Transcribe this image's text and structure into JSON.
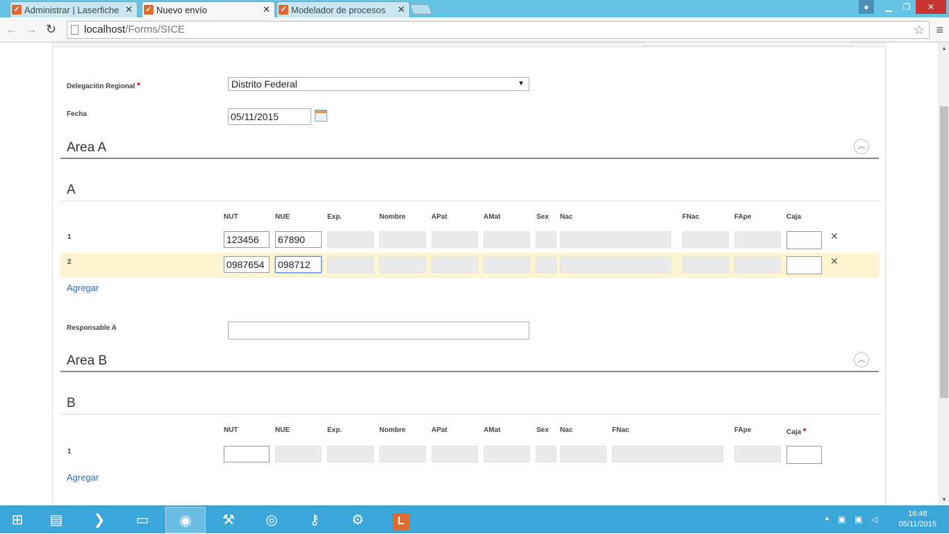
{
  "browser": {
    "tabs": [
      {
        "label": "Administrar | Laserfiche Fo",
        "active": false
      },
      {
        "label": "Nuevo envío",
        "active": true
      },
      {
        "label": "Modelador de procesos | L",
        "active": false
      }
    ],
    "url_host": "localhost",
    "url_path": "/Forms/SICE"
  },
  "form": {
    "delegacion": {
      "label": "Delegación Regional",
      "required_mark": "*",
      "value": "Distrito Federal"
    },
    "fecha": {
      "label": "Fecha",
      "value": "05/11/2015"
    },
    "area_a": {
      "title": "Area A",
      "subtitle": "A",
      "columns": [
        "NUT",
        "NUE",
        "Exp.",
        "Nombre",
        "APat",
        "AMat",
        "Sex",
        "Nac",
        "FNac",
        "FApe",
        "Caja"
      ],
      "rows": [
        {
          "num": "1",
          "nut": "123456",
          "nue": "67890"
        },
        {
          "num": "2",
          "nut": "0987654",
          "nue": "098712"
        }
      ],
      "add_label": "Agregar",
      "responsable_label": "Responsable A"
    },
    "area_b": {
      "title": "Area B",
      "subtitle": "B",
      "columns": [
        "NUT",
        "NUE",
        "Exp.",
        "Nombre",
        "APat",
        "AMat",
        "Sex",
        "Nac",
        "FNac",
        "FApe",
        "Caja"
      ],
      "caja_required_mark": "*",
      "rows": [
        {
          "num": "1"
        }
      ],
      "add_label": "Agregar"
    }
  },
  "taskbar": {
    "time": "16:48",
    "date": "05/11/2015"
  },
  "colors": {
    "tabstrip": "#65c3e3",
    "taskbar": "#3aa6da",
    "link": "#2a6ab6",
    "row_highlight": "#fcf5d0"
  }
}
